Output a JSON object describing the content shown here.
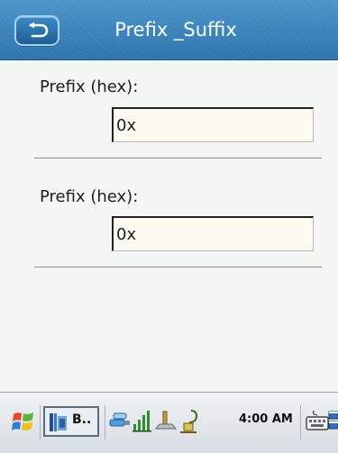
{
  "header": {
    "title": "Prefix _Suffix",
    "back_icon": "back-arrow-icon"
  },
  "form": {
    "rows": [
      {
        "label": "Prefix (hex):",
        "value": "0x"
      },
      {
        "label": "Prefix (hex):",
        "value": "0x"
      }
    ]
  },
  "taskbar": {
    "start_icon": "windows-flag-icon",
    "task_label": "B..",
    "time": "4:00 AM",
    "tray_icons": [
      "connectivity-icon",
      "signal-strength-icon",
      "volume-icon",
      "power-plug-icon",
      "keyboard-icon",
      "window-switch-icon"
    ]
  },
  "colors": {
    "header": "#2e78b3",
    "background": "#f4f6f3",
    "field_background": "#fbfbf2",
    "taskbar": "#e1e6ea"
  }
}
